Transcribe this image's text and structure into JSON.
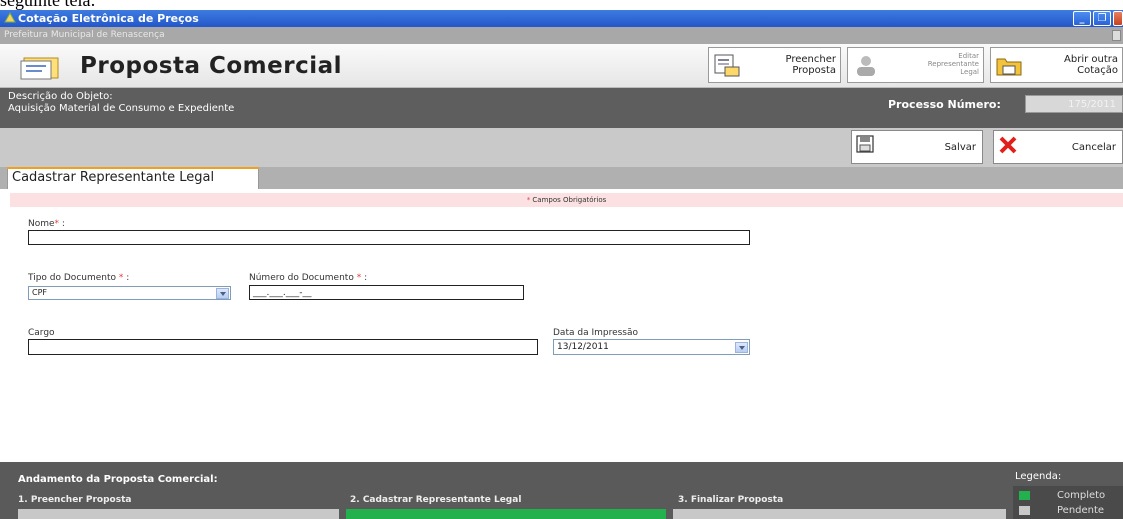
{
  "doc_text": "seguinte tela:",
  "window": {
    "title": "Cotação Eletrônica de Preços",
    "org": "Prefeitura Municipal de Renascença"
  },
  "header": {
    "title": "Proposta Comercial",
    "buttons": [
      {
        "label_line1": "Preencher",
        "label_line2": "Proposta"
      },
      {
        "label_line1": "Editar",
        "label_line2": "Representante",
        "label_line3": "Legal"
      },
      {
        "label_line1": "Abrir outra",
        "label_line2": "Cotação"
      }
    ]
  },
  "description": {
    "label": "Descrição do Objeto:",
    "value": "Aquisição Material de Consumo e Expediente",
    "process_label": "Processo Número:",
    "process_value": "175/2011"
  },
  "actions": {
    "save_label": "Salvar",
    "cancel_label": "Cancelar"
  },
  "tab": {
    "label": "Cadastrar Representante Legal"
  },
  "required_note": "Campos Obrigatórios",
  "form": {
    "nome_label": "Nome",
    "nome_value": "",
    "tipo_label": "Tipo do Documento",
    "tipo_value": "CPF",
    "numero_label": "Número do Documento",
    "numero_value": "___.___.___-__",
    "cargo_label": "Cargo",
    "cargo_value": "",
    "data_label": "Data da Impressão",
    "data_value": "13/12/2011"
  },
  "progress": {
    "title": "Andamento da Proposta Comercial:",
    "steps": [
      {
        "label": "1. Preencher Proposta",
        "status": "Pendente"
      },
      {
        "label": "2. Cadastrar Representante Legal",
        "status": "Completo"
      },
      {
        "label": "3. Finalizar Proposta",
        "status": "Pendente"
      }
    ],
    "legend_title": "Legenda:",
    "legend": [
      {
        "label": "Completo",
        "color": "#22b14c"
      },
      {
        "label": "Pendente",
        "color": "#c8c8c8"
      }
    ]
  },
  "colors": {
    "complete": "#22b14c",
    "pending": "#c8c8c8",
    "title_bar": "#2a62d6"
  }
}
